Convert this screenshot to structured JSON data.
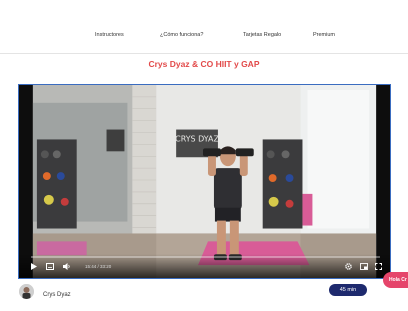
{
  "nav": {
    "items": [
      "Instructores",
      "¿Cómo funciona?",
      "Tarjetas Regalo",
      "Premium"
    ]
  },
  "course": {
    "title": "Crys Dyaz & CO HIIT y GAP"
  },
  "player": {
    "time_display": "15:44 / 33:20",
    "progress": 0,
    "wall_logo": "CRYS DYAZ",
    "icons": [
      "play-icon",
      "subtitles-icon",
      "volume-icon",
      "settings-icon",
      "pip-icon",
      "fullscreen-icon"
    ]
  },
  "instructor": {
    "name": "Crys Dyaz",
    "duration": "45 min"
  },
  "chat": {
    "label": "Hola Cr"
  },
  "colors": {
    "accent": "#e24a4a",
    "badge": "#1e2a6e",
    "chat": "#e5456b",
    "player_border": "#3a6cc0"
  }
}
